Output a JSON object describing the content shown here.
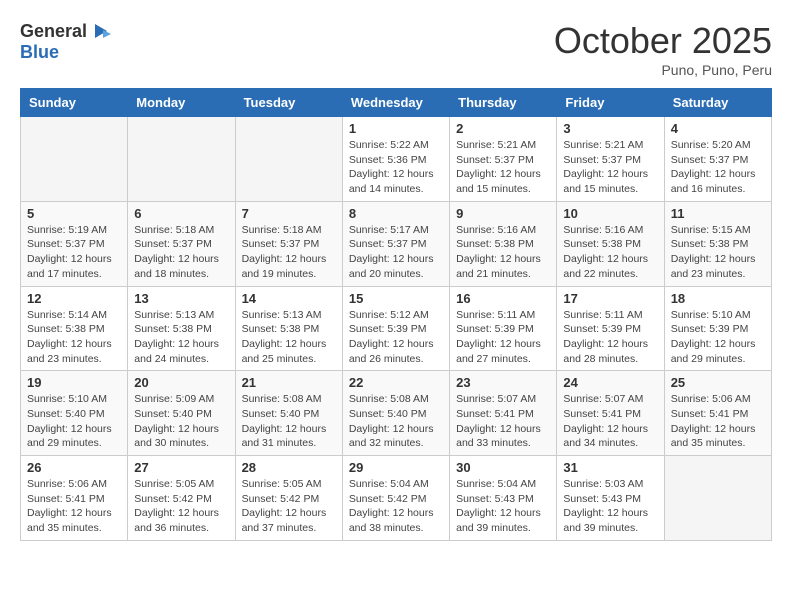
{
  "header": {
    "logo_general": "General",
    "logo_blue": "Blue",
    "month_title": "October 2025",
    "subtitle": "Puno, Puno, Peru"
  },
  "weekdays": [
    "Sunday",
    "Monday",
    "Tuesday",
    "Wednesday",
    "Thursday",
    "Friday",
    "Saturday"
  ],
  "weeks": [
    [
      {
        "day": "",
        "info": ""
      },
      {
        "day": "",
        "info": ""
      },
      {
        "day": "",
        "info": ""
      },
      {
        "day": "1",
        "info": "Sunrise: 5:22 AM\nSunset: 5:36 PM\nDaylight: 12 hours\nand 14 minutes."
      },
      {
        "day": "2",
        "info": "Sunrise: 5:21 AM\nSunset: 5:37 PM\nDaylight: 12 hours\nand 15 minutes."
      },
      {
        "day": "3",
        "info": "Sunrise: 5:21 AM\nSunset: 5:37 PM\nDaylight: 12 hours\nand 15 minutes."
      },
      {
        "day": "4",
        "info": "Sunrise: 5:20 AM\nSunset: 5:37 PM\nDaylight: 12 hours\nand 16 minutes."
      }
    ],
    [
      {
        "day": "5",
        "info": "Sunrise: 5:19 AM\nSunset: 5:37 PM\nDaylight: 12 hours\nand 17 minutes."
      },
      {
        "day": "6",
        "info": "Sunrise: 5:18 AM\nSunset: 5:37 PM\nDaylight: 12 hours\nand 18 minutes."
      },
      {
        "day": "7",
        "info": "Sunrise: 5:18 AM\nSunset: 5:37 PM\nDaylight: 12 hours\nand 19 minutes."
      },
      {
        "day": "8",
        "info": "Sunrise: 5:17 AM\nSunset: 5:37 PM\nDaylight: 12 hours\nand 20 minutes."
      },
      {
        "day": "9",
        "info": "Sunrise: 5:16 AM\nSunset: 5:38 PM\nDaylight: 12 hours\nand 21 minutes."
      },
      {
        "day": "10",
        "info": "Sunrise: 5:16 AM\nSunset: 5:38 PM\nDaylight: 12 hours\nand 22 minutes."
      },
      {
        "day": "11",
        "info": "Sunrise: 5:15 AM\nSunset: 5:38 PM\nDaylight: 12 hours\nand 23 minutes."
      }
    ],
    [
      {
        "day": "12",
        "info": "Sunrise: 5:14 AM\nSunset: 5:38 PM\nDaylight: 12 hours\nand 23 minutes."
      },
      {
        "day": "13",
        "info": "Sunrise: 5:13 AM\nSunset: 5:38 PM\nDaylight: 12 hours\nand 24 minutes."
      },
      {
        "day": "14",
        "info": "Sunrise: 5:13 AM\nSunset: 5:38 PM\nDaylight: 12 hours\nand 25 minutes."
      },
      {
        "day": "15",
        "info": "Sunrise: 5:12 AM\nSunset: 5:39 PM\nDaylight: 12 hours\nand 26 minutes."
      },
      {
        "day": "16",
        "info": "Sunrise: 5:11 AM\nSunset: 5:39 PM\nDaylight: 12 hours\nand 27 minutes."
      },
      {
        "day": "17",
        "info": "Sunrise: 5:11 AM\nSunset: 5:39 PM\nDaylight: 12 hours\nand 28 minutes."
      },
      {
        "day": "18",
        "info": "Sunrise: 5:10 AM\nSunset: 5:39 PM\nDaylight: 12 hours\nand 29 minutes."
      }
    ],
    [
      {
        "day": "19",
        "info": "Sunrise: 5:10 AM\nSunset: 5:40 PM\nDaylight: 12 hours\nand 29 minutes."
      },
      {
        "day": "20",
        "info": "Sunrise: 5:09 AM\nSunset: 5:40 PM\nDaylight: 12 hours\nand 30 minutes."
      },
      {
        "day": "21",
        "info": "Sunrise: 5:08 AM\nSunset: 5:40 PM\nDaylight: 12 hours\nand 31 minutes."
      },
      {
        "day": "22",
        "info": "Sunrise: 5:08 AM\nSunset: 5:40 PM\nDaylight: 12 hours\nand 32 minutes."
      },
      {
        "day": "23",
        "info": "Sunrise: 5:07 AM\nSunset: 5:41 PM\nDaylight: 12 hours\nand 33 minutes."
      },
      {
        "day": "24",
        "info": "Sunrise: 5:07 AM\nSunset: 5:41 PM\nDaylight: 12 hours\nand 34 minutes."
      },
      {
        "day": "25",
        "info": "Sunrise: 5:06 AM\nSunset: 5:41 PM\nDaylight: 12 hours\nand 35 minutes."
      }
    ],
    [
      {
        "day": "26",
        "info": "Sunrise: 5:06 AM\nSunset: 5:41 PM\nDaylight: 12 hours\nand 35 minutes."
      },
      {
        "day": "27",
        "info": "Sunrise: 5:05 AM\nSunset: 5:42 PM\nDaylight: 12 hours\nand 36 minutes."
      },
      {
        "day": "28",
        "info": "Sunrise: 5:05 AM\nSunset: 5:42 PM\nDaylight: 12 hours\nand 37 minutes."
      },
      {
        "day": "29",
        "info": "Sunrise: 5:04 AM\nSunset: 5:42 PM\nDaylight: 12 hours\nand 38 minutes."
      },
      {
        "day": "30",
        "info": "Sunrise: 5:04 AM\nSunset: 5:43 PM\nDaylight: 12 hours\nand 39 minutes."
      },
      {
        "day": "31",
        "info": "Sunrise: 5:03 AM\nSunset: 5:43 PM\nDaylight: 12 hours\nand 39 minutes."
      },
      {
        "day": "",
        "info": ""
      }
    ]
  ]
}
